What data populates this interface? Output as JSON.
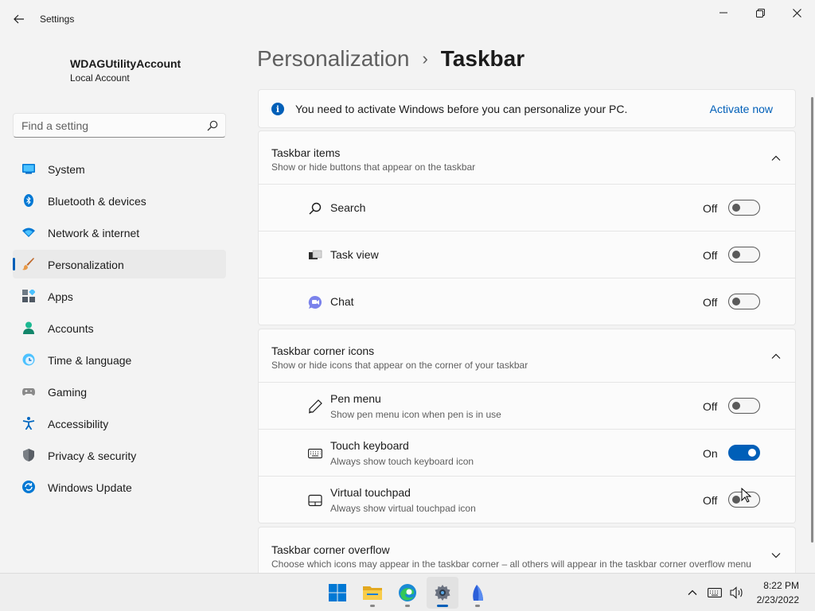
{
  "window": {
    "title": "Settings",
    "back_icon": "back-arrow-icon",
    "controls": [
      "minimize-icon",
      "restore-icon",
      "close-icon"
    ]
  },
  "profile": {
    "name": "WDAGUtilityAccount",
    "account_type": "Local Account"
  },
  "search": {
    "placeholder": "Find a setting",
    "value": ""
  },
  "sidebar": {
    "items": [
      {
        "label": "System",
        "icon": "system-icon",
        "active": false
      },
      {
        "label": "Bluetooth & devices",
        "icon": "bluetooth-icon",
        "active": false
      },
      {
        "label": "Network & internet",
        "icon": "network-icon",
        "active": false
      },
      {
        "label": "Personalization",
        "icon": "brush-icon",
        "active": true
      },
      {
        "label": "Apps",
        "icon": "apps-icon",
        "active": false
      },
      {
        "label": "Accounts",
        "icon": "accounts-icon",
        "active": false
      },
      {
        "label": "Time & language",
        "icon": "time-language-icon",
        "active": false
      },
      {
        "label": "Gaming",
        "icon": "gaming-icon",
        "active": false
      },
      {
        "label": "Accessibility",
        "icon": "accessibility-icon",
        "active": false
      },
      {
        "label": "Privacy & security",
        "icon": "shield-icon",
        "active": false
      },
      {
        "label": "Windows Update",
        "icon": "update-icon",
        "active": false
      }
    ]
  },
  "breadcrumb": {
    "parent": "Personalization",
    "separator": "›",
    "current": "Taskbar"
  },
  "banner": {
    "text": "You need to activate Windows before you can personalize your PC.",
    "link": "Activate now"
  },
  "sections": {
    "taskbar_items": {
      "title": "Taskbar items",
      "subtitle": "Show or hide buttons that appear on the taskbar",
      "expanded": true,
      "rows": [
        {
          "label": "Search",
          "state": "Off",
          "on": false,
          "icon": "search-icon"
        },
        {
          "label": "Task view",
          "state": "Off",
          "on": false,
          "icon": "task-view-icon"
        },
        {
          "label": "Chat",
          "state": "Off",
          "on": false,
          "icon": "chat-icon"
        }
      ]
    },
    "corner_icons": {
      "title": "Taskbar corner icons",
      "subtitle": "Show or hide icons that appear on the corner of your taskbar",
      "expanded": true,
      "rows": [
        {
          "label": "Pen menu",
          "description": "Show pen menu icon when pen is in use",
          "state": "Off",
          "on": false,
          "icon": "pen-icon"
        },
        {
          "label": "Touch keyboard",
          "description": "Always show touch keyboard icon",
          "state": "On",
          "on": true,
          "icon": "keyboard-icon"
        },
        {
          "label": "Virtual touchpad",
          "description": "Always show virtual touchpad icon",
          "state": "Off",
          "on": false,
          "icon": "touchpad-icon"
        }
      ]
    },
    "corner_overflow": {
      "title": "Taskbar corner overflow",
      "subtitle": "Choose which icons may appear in the taskbar corner – all others will appear in the taskbar corner overflow menu",
      "expanded": false
    }
  },
  "taskbar": {
    "apps": [
      "start-icon",
      "file-explorer-icon",
      "edge-icon",
      "settings-icon",
      "sail-app-icon"
    ],
    "tray": [
      "chevron-up-icon",
      "keyboard-tray-icon",
      "speaker-icon"
    ],
    "time": "8:22 PM",
    "date": "2/23/2022"
  },
  "colors": {
    "accent": "#005fb8",
    "background": "#f3f3f3",
    "card": "#fbfbfb"
  }
}
